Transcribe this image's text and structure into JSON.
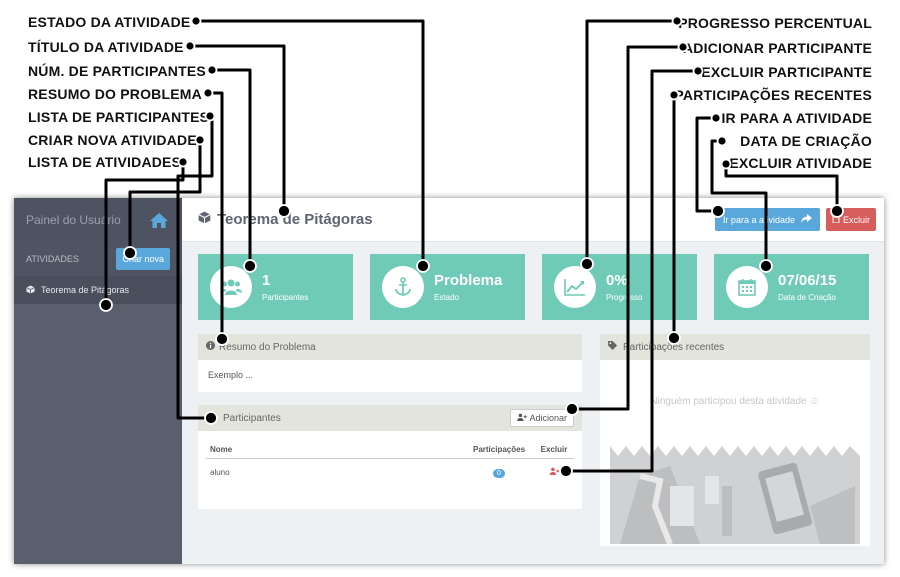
{
  "annotations": {
    "left": [
      "ESTADO DA ATIVIDADE",
      "TÍTULO DA ATIVIDADE",
      "NÚM. DE PARTICIPANTES",
      "RESUMO DO PROBLEMA",
      "LISTA DE PARTICIPANTES",
      "CRIAR NOVA ATIVIDADE",
      "LISTA DE ATIVIDADES"
    ],
    "right": [
      "PROGRESSO PERCENTUAL",
      "ADICIONAR PARTICIPANTE",
      "EXCLUIR PARTICIPANTE",
      "PARTICIPAÇÕES RECENTES",
      "IR PARA A ATIVIDADE",
      "DATA DE CRIAÇÃO",
      "EXCLUIR ATIVIDADE"
    ]
  },
  "sidebar": {
    "title": "Painel do Usuário",
    "section_label": "ATIVIDADES",
    "create_button": "Criar nova",
    "items": [
      {
        "label": "Teorema de Pitágoras"
      }
    ]
  },
  "header": {
    "title": "Teorema de Pitágoras",
    "go_button": "Ir para a atividade",
    "delete_button": "Excluir"
  },
  "stats": [
    {
      "value": "1",
      "label": "Participantes",
      "icon": "users-icon"
    },
    {
      "value": "Problema",
      "label": "Estado",
      "icon": "anchor-icon"
    },
    {
      "value": "0%",
      "label": "Progresso",
      "icon": "chart-line-icon"
    },
    {
      "value": "07/06/15",
      "label": "Data de Criação",
      "icon": "calendar-icon"
    }
  ],
  "summary": {
    "title": "Resumo do Problema",
    "text": "Exemplo ..."
  },
  "participants": {
    "title": "Participantes",
    "add_button": "Adicionar",
    "columns": [
      "Nome",
      "Participações",
      "Excluir"
    ],
    "rows": [
      {
        "name": "aluno",
        "count": "0"
      }
    ]
  },
  "recent": {
    "title": "Participações recentes",
    "empty_text": "Ninguém participou desta atividade"
  },
  "colors": {
    "accent": "#5aa7dc",
    "stat_bg": "#6fcbb7",
    "danger": "#d75d5d",
    "sidebar": "#5a5f6e"
  }
}
